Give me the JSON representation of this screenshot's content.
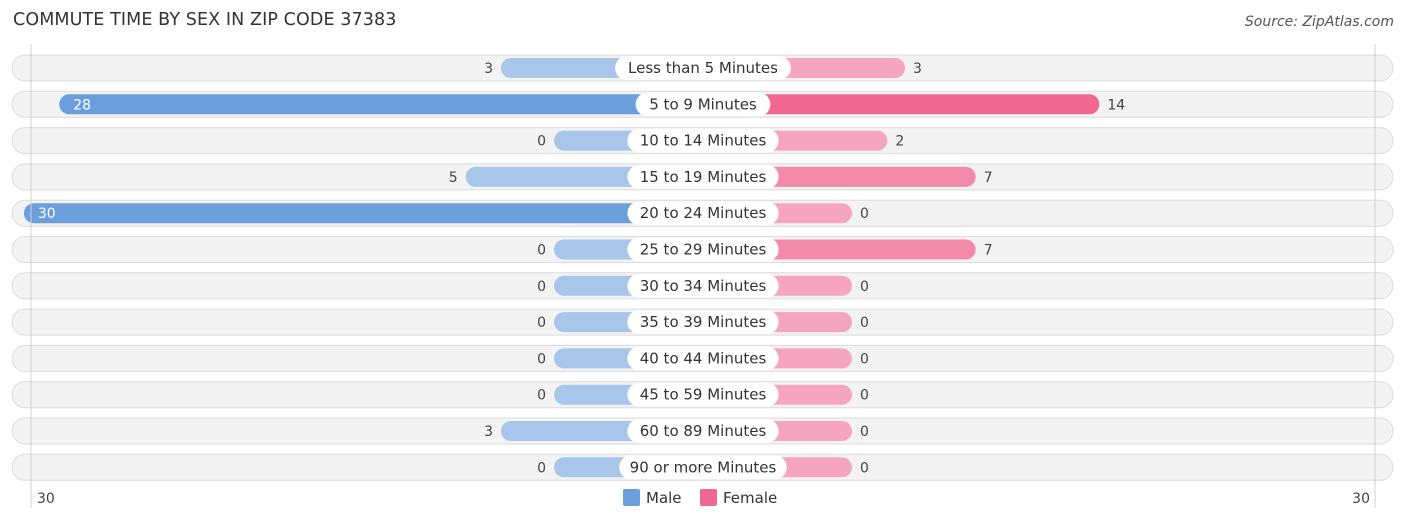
{
  "header": {
    "title": "COMMUTE TIME BY SEX IN ZIP CODE 37383",
    "source": "Source: ZipAtlas.com"
  },
  "chart_data": {
    "type": "bar",
    "orientation": "horizontal-diverging",
    "title": "COMMUTE TIME BY SEX IN ZIP CODE 37383",
    "categories": [
      "Less than 5 Minutes",
      "5 to 9 Minutes",
      "10 to 14 Minutes",
      "15 to 19 Minutes",
      "20 to 24 Minutes",
      "25 to 29 Minutes",
      "30 to 34 Minutes",
      "35 to 39 Minutes",
      "40 to 44 Minutes",
      "45 to 59 Minutes",
      "60 to 89 Minutes",
      "90 or more Minutes"
    ],
    "series": [
      {
        "name": "Male",
        "color": "#6a9fdc",
        "light_color": "#a7c6ea",
        "values": [
          3,
          28,
          0,
          5,
          30,
          0,
          0,
          0,
          0,
          0,
          3,
          0
        ]
      },
      {
        "name": "Female",
        "color": "#f06892",
        "light_color": "#f5a5bf",
        "values": [
          3,
          14,
          2,
          7,
          0,
          7,
          0,
          0,
          0,
          0,
          0,
          0
        ]
      }
    ],
    "axis": {
      "left_tick": "30",
      "right_tick": "30",
      "max": 30
    },
    "legend": {
      "position": "bottom-center",
      "items": [
        "Male",
        "Female"
      ]
    }
  }
}
